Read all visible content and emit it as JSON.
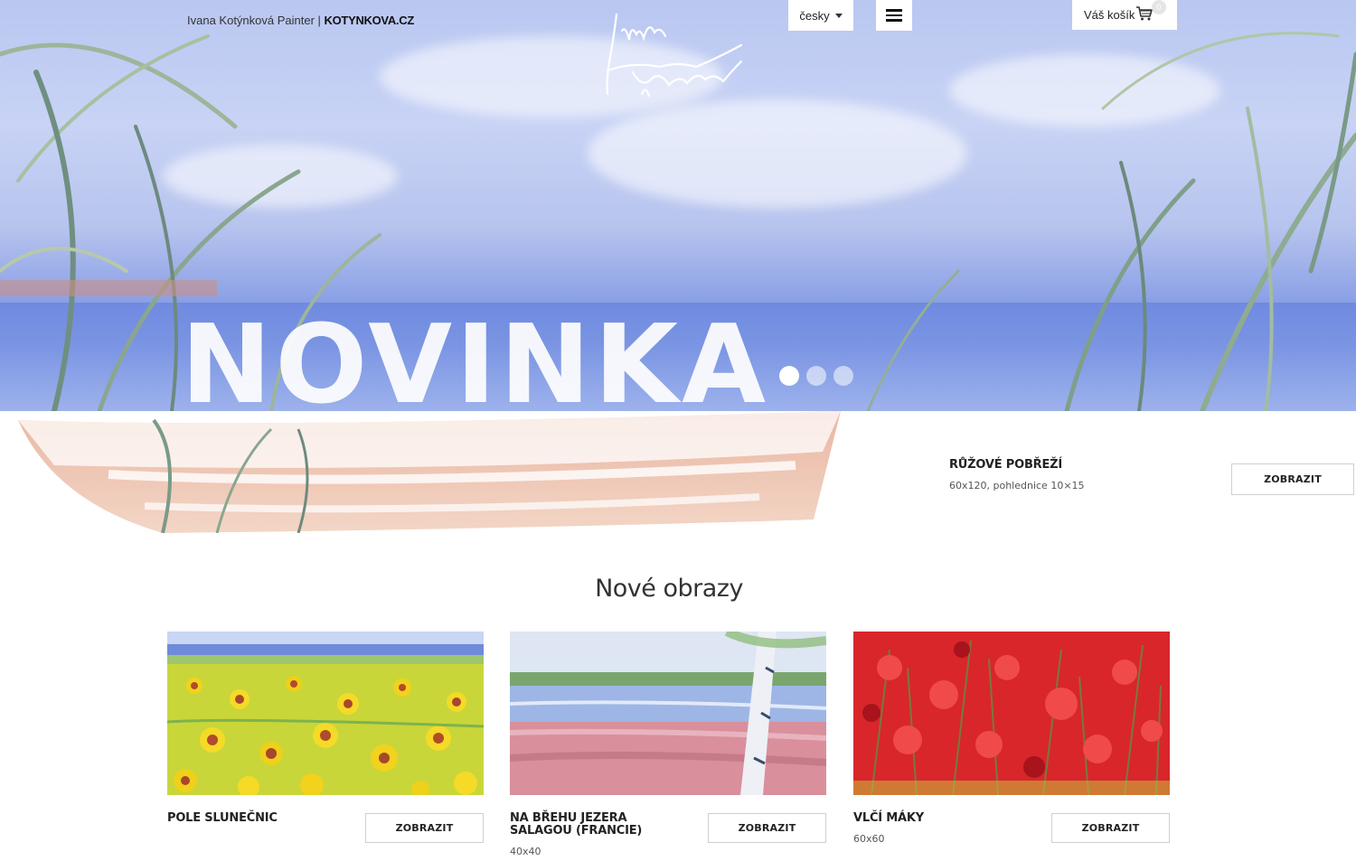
{
  "header": {
    "site_tag_prefix": "Ivana Kotýnková Painter | ",
    "site_tag_brand": "KOTYNKOVA.CZ",
    "logo_alt": "Ivana Kotýnková",
    "language": "česky",
    "cart_label": "Váš košík",
    "cart_count": "0"
  },
  "hero": {
    "headline": "NOVINKA",
    "slides_total": 3,
    "active_slide": 1
  },
  "featured": {
    "title": "RŮŽOVÉ POBŘEŽÍ",
    "size": "60x120, pohlednice 10×15",
    "button": "ZOBRAZIT"
  },
  "new_paintings": {
    "heading": "Nové obrazy",
    "items": [
      {
        "title": "POLE SLUNEČNIC",
        "size": "",
        "button": "ZOBRAZIT"
      },
      {
        "title": "NA BŘEHU JEZERA SALAGOU (FRANCIE)",
        "size": "40x40",
        "button": "ZOBRAZIT"
      },
      {
        "title": "VLČÍ MÁKY",
        "size": "60x60",
        "button": "ZOBRAZIT"
      }
    ]
  },
  "colors": {
    "sky": "#c8d3f5",
    "sea": "#6f8be0",
    "button_border": "#cfcfcf"
  }
}
